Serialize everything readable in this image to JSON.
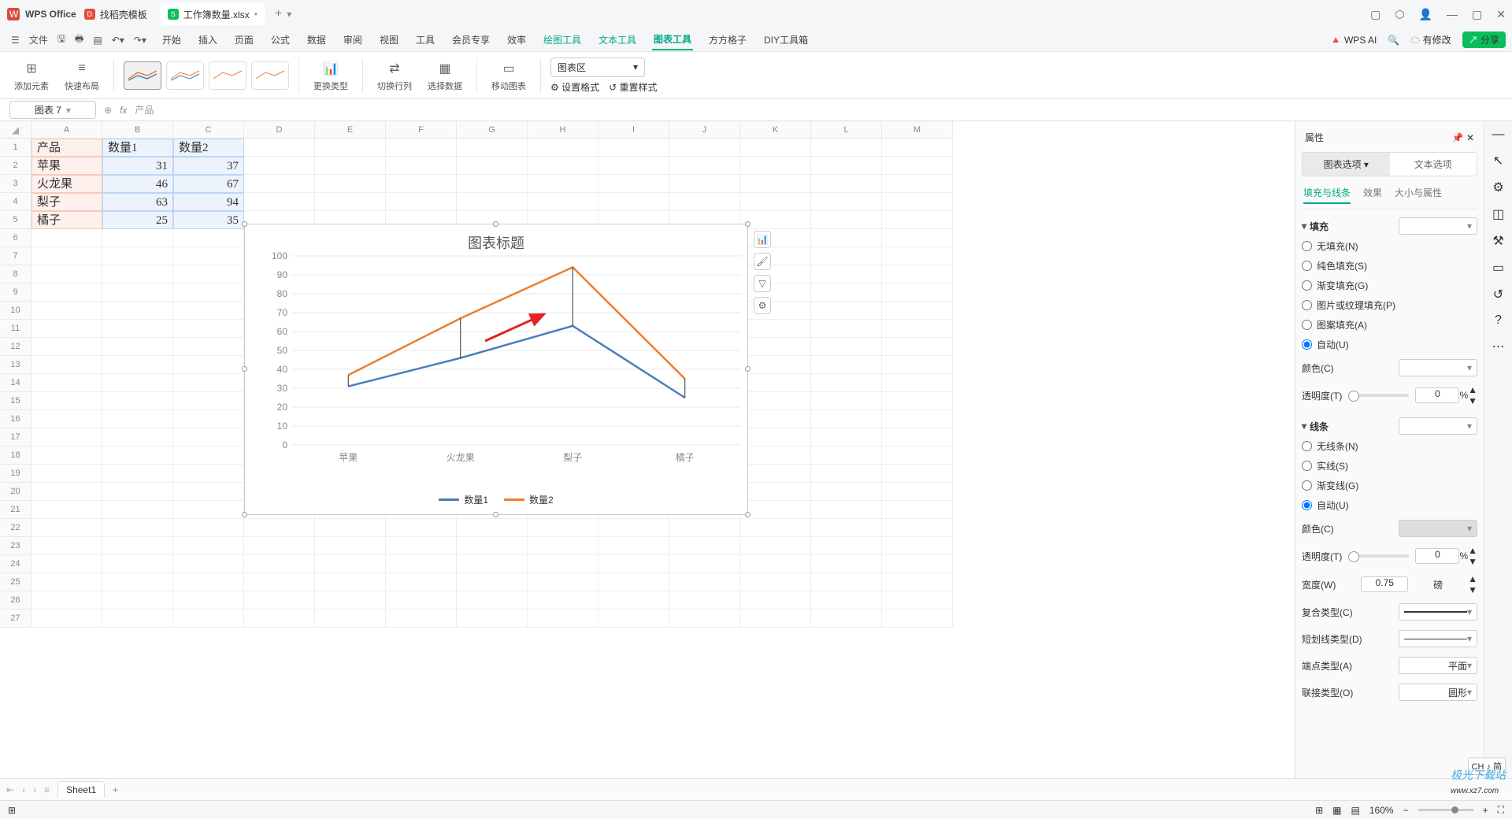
{
  "titlebar": {
    "app": "WPS Office",
    "tab1": "找稻壳模板",
    "tab2": "工作簿数量.xlsx"
  },
  "menubar": {
    "file": "文件",
    "items": [
      "开始",
      "插入",
      "页面",
      "公式",
      "数据",
      "审阅",
      "视图",
      "工具",
      "会员专享",
      "效率",
      "绘图工具",
      "文本工具",
      "图表工具",
      "方方格子",
      "DIY工具箱"
    ],
    "wpsai": "WPS AI",
    "modify": "有修改",
    "share": "分享"
  },
  "ribbon": {
    "addelem": "添加元素",
    "quicklayout": "快速布局",
    "changetype": "更换类型",
    "switchrc": "切换行列",
    "seldata": "选择数据",
    "movechart": "移动图表",
    "chartarea": "图表区",
    "setfmt": "设置格式",
    "resetstyle": "重置样式"
  },
  "formula": {
    "name": "图表 7",
    "fx": "fx",
    "content": "产品"
  },
  "cols": [
    "A",
    "B",
    "C",
    "D",
    "E",
    "F",
    "G",
    "H",
    "I",
    "J",
    "K",
    "L",
    "M"
  ],
  "rows": [
    "1",
    "2",
    "3",
    "4",
    "5",
    "6",
    "7",
    "8",
    "9",
    "10",
    "11",
    "12",
    "13",
    "14",
    "15",
    "16",
    "17",
    "18",
    "19",
    "20",
    "21",
    "22",
    "23",
    "24",
    "25",
    "26",
    "27"
  ],
  "data": {
    "h": [
      "产品",
      "数量1",
      "数量2"
    ],
    "r": [
      [
        "苹果",
        "31",
        "37"
      ],
      [
        "火龙果",
        "46",
        "67"
      ],
      [
        "梨子",
        "63",
        "94"
      ],
      [
        "橘子",
        "25",
        "35"
      ]
    ]
  },
  "chart_data": {
    "type": "line",
    "title": "图表标题",
    "categories": [
      "苹果",
      "火龙果",
      "梨子",
      "橘子"
    ],
    "series": [
      {
        "name": "数量1",
        "values": [
          31,
          46,
          63,
          25
        ],
        "color": "#4a7ebb"
      },
      {
        "name": "数量2",
        "values": [
          37,
          67,
          94,
          35
        ],
        "color": "#ed7d31"
      }
    ],
    "ylim": [
      0,
      100
    ],
    "ystep": 10
  },
  "panel": {
    "title": "属性",
    "tabs": [
      "图表选项",
      "文本选项"
    ],
    "subtabs": [
      "填充与线条",
      "效果",
      "大小与属性"
    ],
    "fill": {
      "title": "填充",
      "opts": [
        "无填充(N)",
        "纯色填充(S)",
        "渐变填充(G)",
        "图片或纹理填充(P)",
        "图案填充(A)",
        "自动(U)"
      ],
      "color": "颜色(C)",
      "trans": "透明度(T)",
      "transval": "0",
      "pct": "%"
    },
    "line": {
      "title": "线条",
      "opts": [
        "无线条(N)",
        "实线(S)",
        "渐变线(G)",
        "自动(U)"
      ],
      "color": "颜色(C)",
      "trans": "透明度(T)",
      "transval": "0",
      "pct": "%",
      "width": "宽度(W)",
      "widthval": "0.75",
      "unit": "磅",
      "compound": "复合类型(C)",
      "dash": "短划线类型(D)",
      "cap": "端点类型(A)",
      "capval": "平面",
      "join": "联接类型(O)",
      "joinval": "圆形"
    }
  },
  "tabs": {
    "sheet1": "Sheet1"
  },
  "status": {
    "zoom": "160%"
  },
  "ime": "CH ♪ 简"
}
